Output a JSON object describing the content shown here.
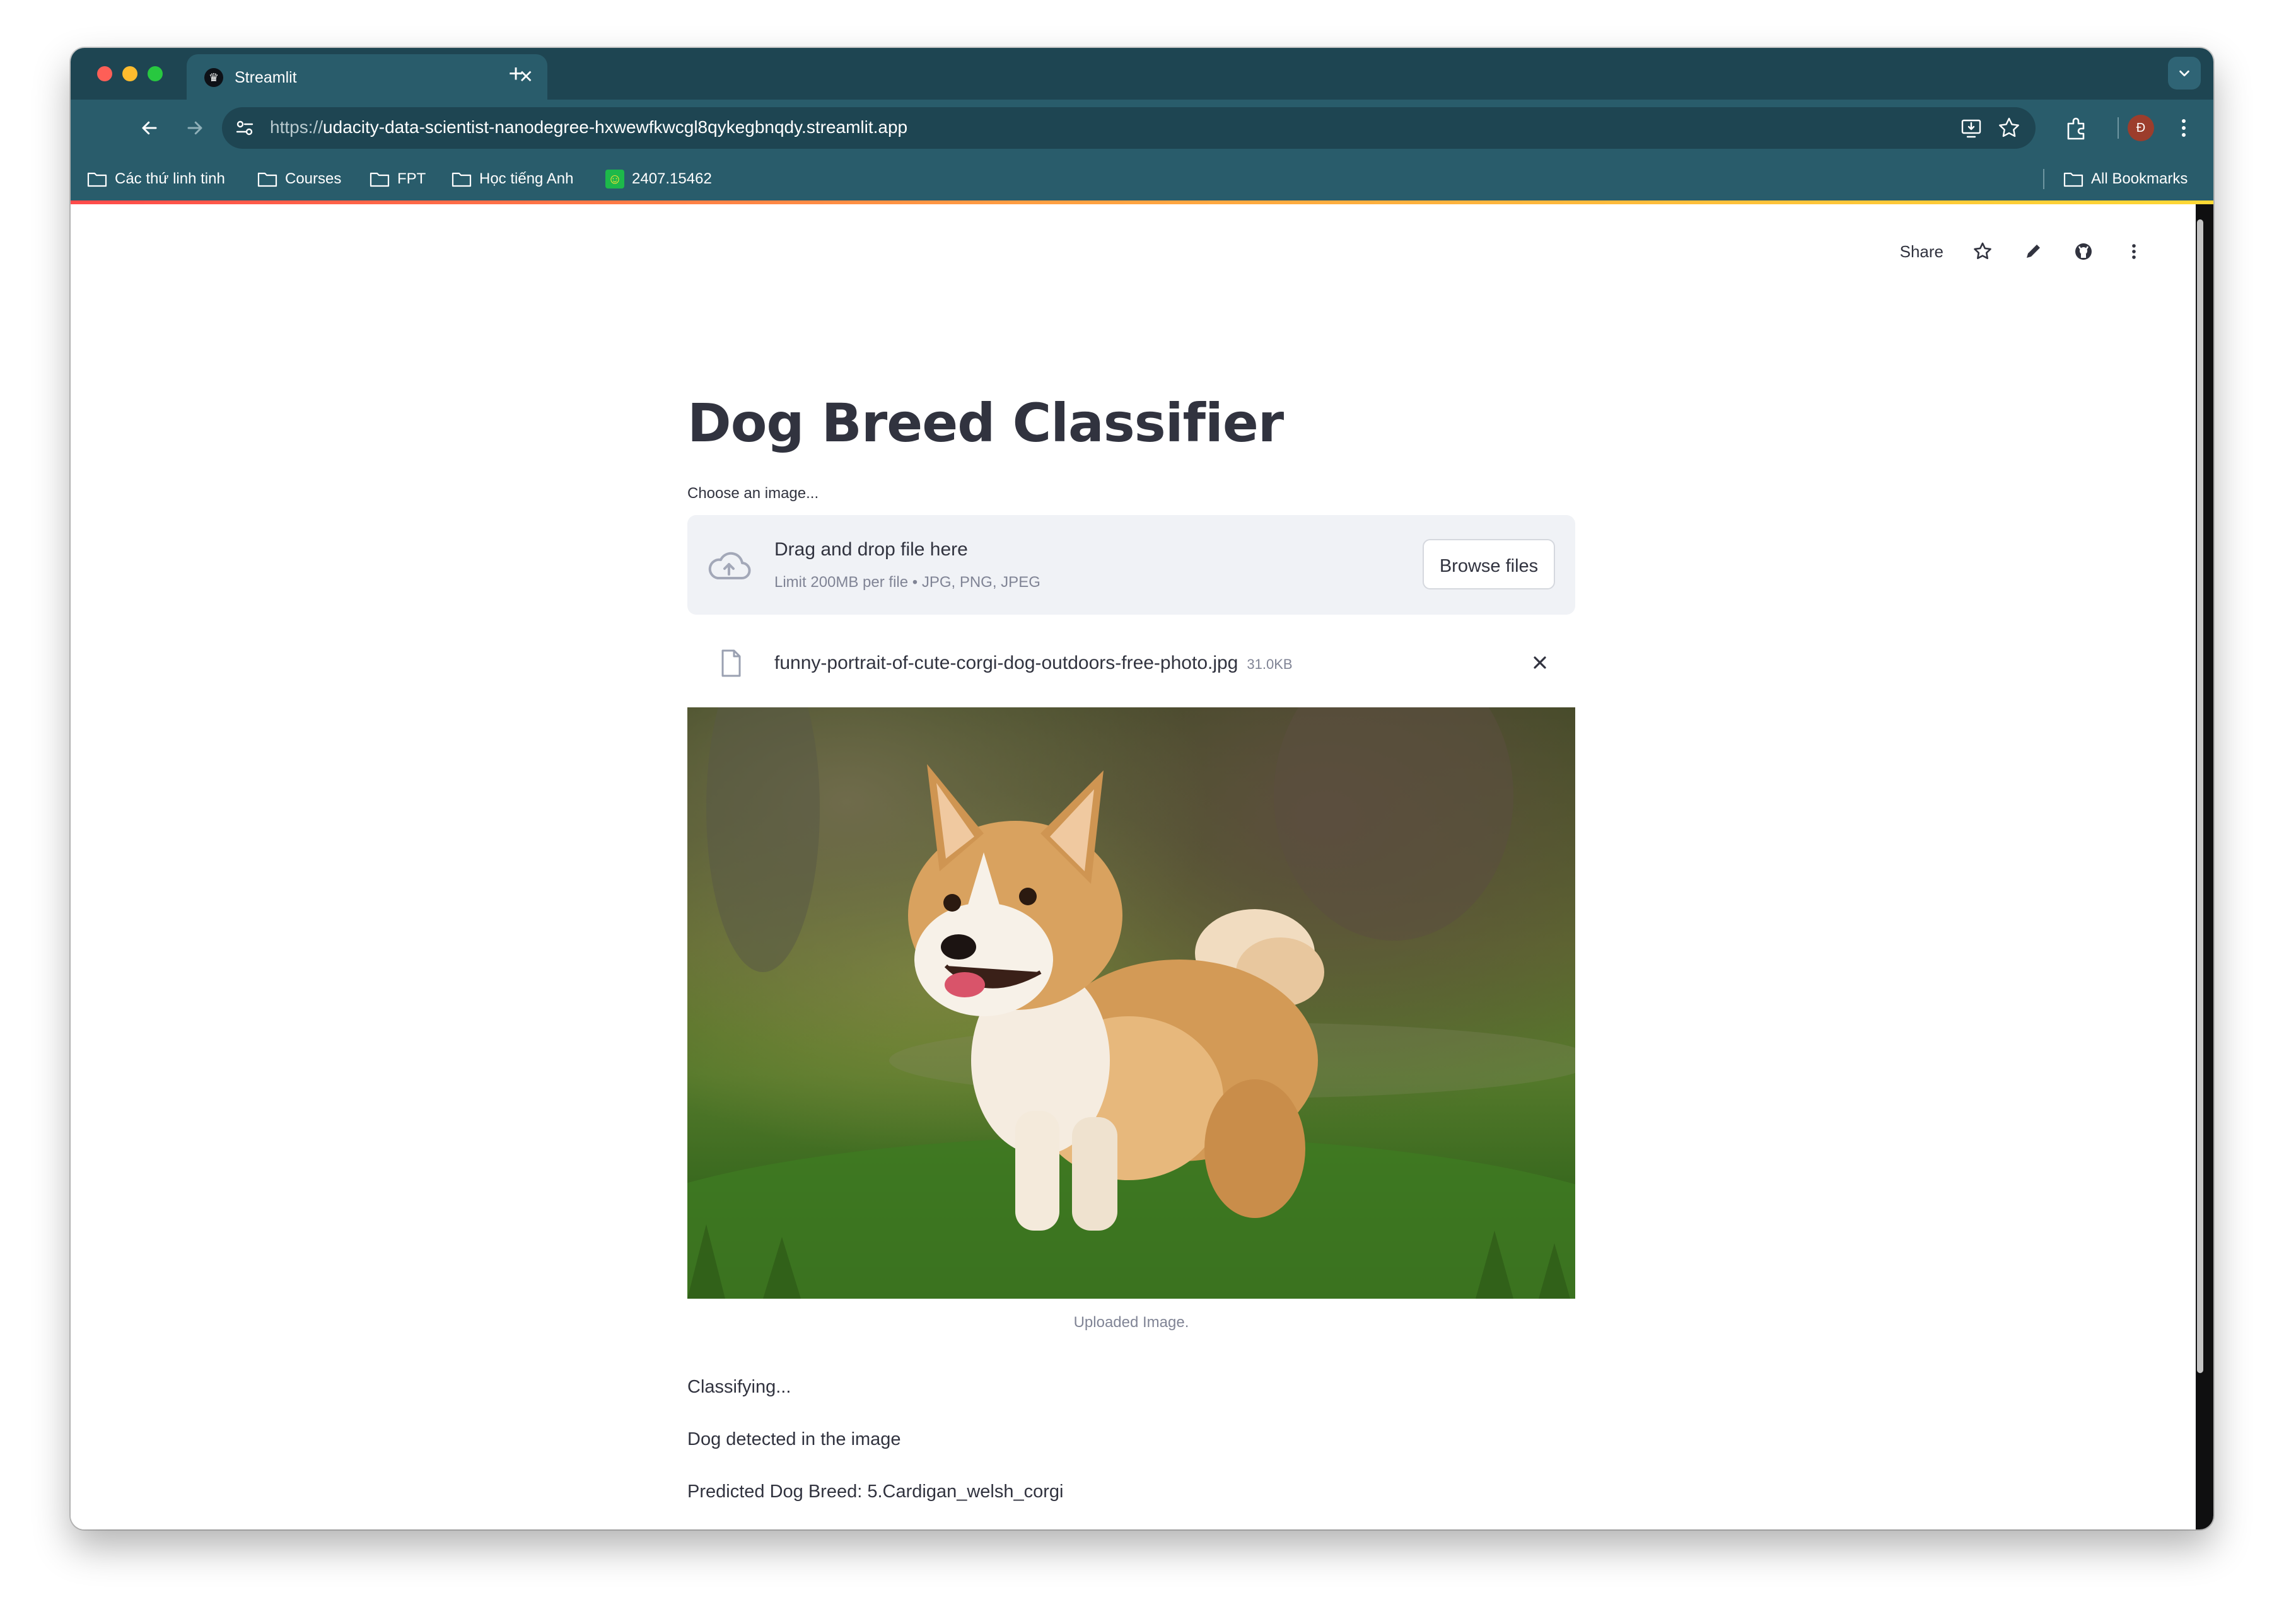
{
  "browser": {
    "tab_title": "Streamlit",
    "url_scheme": "https://",
    "url_host": "udacity-data-scientist-nanodegree-hxwewfkwcgl8qykegbnqdy.streamlit.app",
    "profile_initial": "Đ",
    "bookmarks": [
      {
        "label": "Các thứ linh tinh",
        "icon": "folder-icon"
      },
      {
        "label": "Courses",
        "icon": "folder-icon"
      },
      {
        "label": "FPT",
        "icon": "folder-icon"
      },
      {
        "label": "Học tiếng Anh",
        "icon": "folder-icon"
      },
      {
        "label": "2407.15462",
        "icon": "site-favicon"
      }
    ],
    "all_bookmarks": "All Bookmarks"
  },
  "header": {
    "share_label": "Share"
  },
  "main": {
    "title": "Dog Breed Classifier",
    "uploader_label": "Choose an image...",
    "dropzone_title": "Drag and drop file here",
    "dropzone_limit": "Limit 200MB per file • JPG, PNG, JPEG",
    "browse_label": "Browse files",
    "file_name": "funny-portrait-of-cute-corgi-dog-outdoors-free-photo.jpg",
    "file_size": "31.0KB",
    "image_caption": "Uploaded Image.",
    "status_classifying": "Classifying...",
    "status_detected": "Dog detected in the image",
    "prediction": "Predicted Dog Breed: 5.Cardigan_welsh_corgi"
  },
  "colors": {
    "tab_bar": "#1e4552",
    "toolbar": "#295c6b",
    "text_primary": "#31333f",
    "text_muted": "#808495",
    "dropzone_bg": "#f0f2f6"
  }
}
